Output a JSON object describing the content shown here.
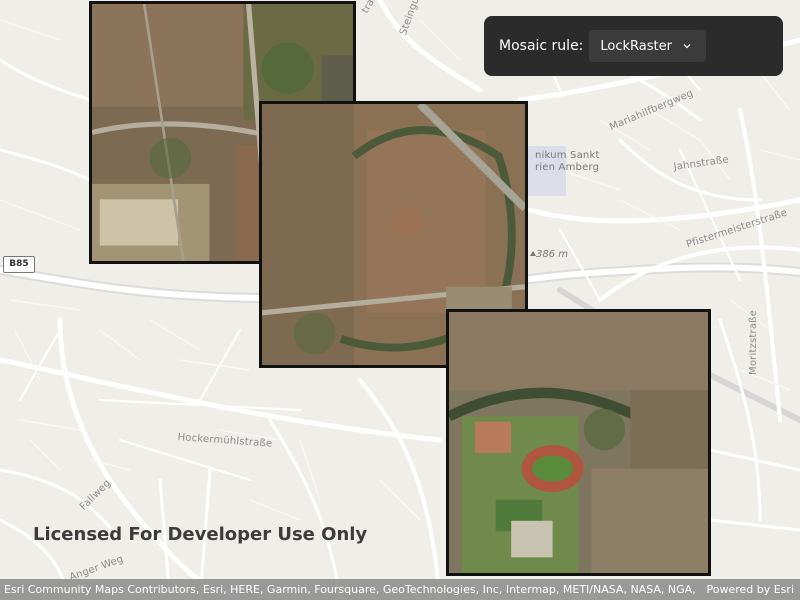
{
  "map": {
    "colors": {
      "background": "#efeee9",
      "roads": "#ffffff",
      "highway": "#d8d8d8",
      "imagery_border": "#111111"
    },
    "street_labels": [
      "Steingutstraße",
      "Mariahilfbergweg",
      "Jahnstraße",
      "Pfistermeisterstraße",
      "Moritzstraße",
      "Hockermühlstraße",
      "Fallweg",
      "Anger Weg",
      "traße"
    ],
    "poi_label": "nikum Sankt\nrien Amberg",
    "route_shield": "B85",
    "elevation": "386 m"
  },
  "imagery_tiles": [
    {
      "name": "tile-1"
    },
    {
      "name": "tile-2"
    },
    {
      "name": "tile-3"
    }
  ],
  "controls": {
    "mosaic_rule_label": "Mosaic rule:",
    "mosaic_rule_value": "LockRaster",
    "chevron_icon": "chevron-down-icon"
  },
  "watermark": "Licensed For Developer Use Only",
  "attribution": {
    "text": "Esri Community Maps Contributors, Esri, HERE, Garmin, Foursquare, GeoTechnologies, Inc, Intermap, METI/NASA, NASA, NGA, USGS",
    "powered_by": "Powered by Esri"
  }
}
